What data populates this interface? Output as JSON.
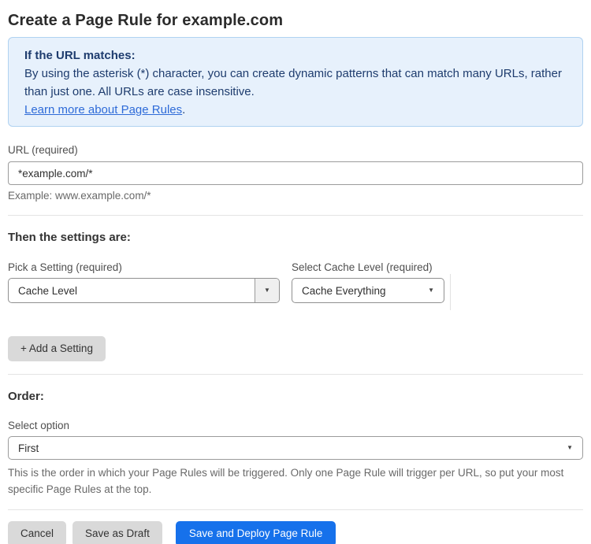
{
  "page": {
    "title": "Create a Page Rule for example.com"
  },
  "info_box": {
    "heading": "If the URL matches:",
    "body": "By using the asterisk (*) character, you can create dynamic patterns that can match many URLs, rather than just one. All URLs are case insensitive.",
    "link_text": "Learn more about Page Rules",
    "link_suffix": "."
  },
  "url_field": {
    "label": "URL (required)",
    "value": "*example.com/*",
    "hint": "Example: www.example.com/*"
  },
  "settings": {
    "heading": "Then the settings are:",
    "pick_setting": {
      "label": "Pick a Setting (required)",
      "selected": "Cache Level"
    },
    "cache_level": {
      "label": "Select Cache Level (required)",
      "selected": "Cache Everything"
    },
    "add_button_label": "+ Add a Setting"
  },
  "order": {
    "heading": "Order:",
    "label": "Select option",
    "selected": "First",
    "hint": "This is the order in which your Page Rules will be triggered. Only one Page Rule will trigger per URL, so put your most specific Page Rules at the top."
  },
  "actions": {
    "cancel": "Cancel",
    "save_draft": "Save as Draft",
    "save_deploy": "Save and Deploy Page Rule"
  },
  "icons": {
    "dropdown_caret": "▼"
  },
  "colors": {
    "accent_blue": "#1671eb",
    "info_background": "#e7f1fc",
    "info_border": "#b0d2f1",
    "info_text": "#1e3c6e",
    "link_blue": "#2e6bd8",
    "button_gray": "#d9d9d9"
  }
}
